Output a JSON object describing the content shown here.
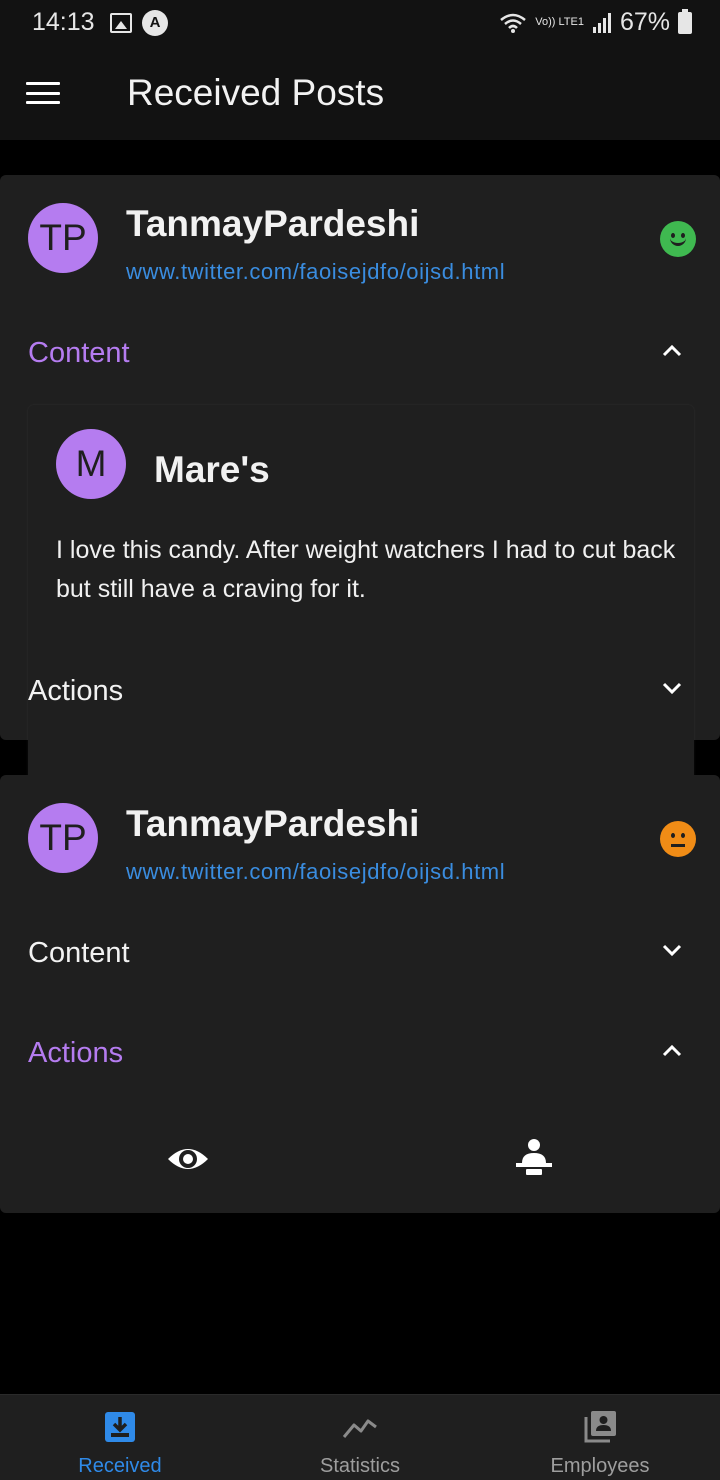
{
  "status_bar": {
    "time": "14:13",
    "network": "Vo)) LTE1",
    "battery": "67%"
  },
  "app_bar": {
    "title": "Received Posts"
  },
  "posts": [
    {
      "avatar_initials": "TP",
      "author": "TanmayPardeshi",
      "link": "www.twitter.com/faoisejdfo/oijsd.html",
      "sentiment": "positive",
      "content_section": {
        "label": "Content",
        "expanded": true
      },
      "actions_section": {
        "label": "Actions",
        "expanded": false
      },
      "content": {
        "avatar_initials": "M",
        "name": "Mare's",
        "text": "I love this candy.  After weight watchers I had to cut back but still have a craving for it."
      }
    },
    {
      "avatar_initials": "TP",
      "author": "TanmayPardeshi",
      "link": "www.twitter.com/faoisejdfo/oijsd.html",
      "sentiment": "neutral",
      "content_section": {
        "label": "Content",
        "expanded": false
      },
      "actions_section": {
        "label": "Actions",
        "expanded": true
      },
      "actions": [
        {
          "icon": "eye-icon"
        },
        {
          "icon": "assign-person-icon"
        }
      ]
    }
  ],
  "colors": {
    "accent": "#b57cf0",
    "link": "#3a8de0",
    "positive": "#3fb950",
    "neutral": "#f08c16",
    "nav_active": "#2f8ae8"
  },
  "bottom_nav": {
    "items": [
      {
        "label": "Received",
        "icon": "inbox-download-icon",
        "active": true
      },
      {
        "label": "Statistics",
        "icon": "trend-line-icon",
        "active": false
      },
      {
        "label": "Employees",
        "icon": "contacts-stack-icon",
        "active": false
      }
    ]
  }
}
